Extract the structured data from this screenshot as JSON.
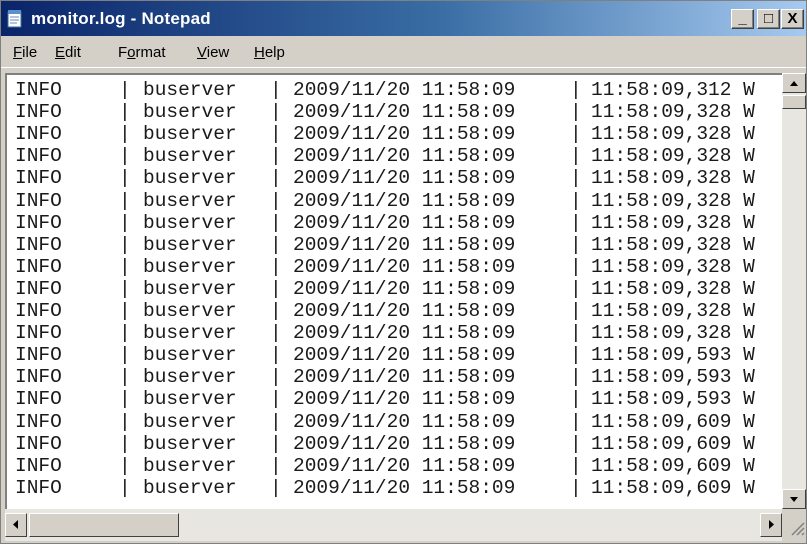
{
  "window": {
    "title": "monitor.log - Notepad",
    "controls": {
      "minimize": "_",
      "maximize": "□",
      "close": "X"
    }
  },
  "menu": {
    "file": {
      "accel": "F",
      "rest": "ile"
    },
    "edit": {
      "accel": "E",
      "rest": "dit"
    },
    "format": {
      "pre": "F",
      "accel": "o",
      "rest": "rmat"
    },
    "view": {
      "accel": "V",
      "rest": "iew"
    },
    "help": {
      "accel": "H",
      "rest": "elp"
    }
  },
  "log": {
    "lines": [
      {
        "level": "INFO",
        "source": "buserver",
        "datetime": "2009/11/20 11:58:09",
        "time": "11:58:09,312 W"
      },
      {
        "level": "INFO",
        "source": "buserver",
        "datetime": "2009/11/20 11:58:09",
        "time": "11:58:09,328 W"
      },
      {
        "level": "INFO",
        "source": "buserver",
        "datetime": "2009/11/20 11:58:09",
        "time": "11:58:09,328 W"
      },
      {
        "level": "INFO",
        "source": "buserver",
        "datetime": "2009/11/20 11:58:09",
        "time": "11:58:09,328 W"
      },
      {
        "level": "INFO",
        "source": "buserver",
        "datetime": "2009/11/20 11:58:09",
        "time": "11:58:09,328 W"
      },
      {
        "level": "INFO",
        "source": "buserver",
        "datetime": "2009/11/20 11:58:09",
        "time": "11:58:09,328 W"
      },
      {
        "level": "INFO",
        "source": "buserver",
        "datetime": "2009/11/20 11:58:09",
        "time": "11:58:09,328 W"
      },
      {
        "level": "INFO",
        "source": "buserver",
        "datetime": "2009/11/20 11:58:09",
        "time": "11:58:09,328 W"
      },
      {
        "level": "INFO",
        "source": "buserver",
        "datetime": "2009/11/20 11:58:09",
        "time": "11:58:09,328 W"
      },
      {
        "level": "INFO",
        "source": "buserver",
        "datetime": "2009/11/20 11:58:09",
        "time": "11:58:09,328 W"
      },
      {
        "level": "INFO",
        "source": "buserver",
        "datetime": "2009/11/20 11:58:09",
        "time": "11:58:09,328 W"
      },
      {
        "level": "INFO",
        "source": "buserver",
        "datetime": "2009/11/20 11:58:09",
        "time": "11:58:09,328 W"
      },
      {
        "level": "INFO",
        "source": "buserver",
        "datetime": "2009/11/20 11:58:09",
        "time": "11:58:09,593 W"
      },
      {
        "level": "INFO",
        "source": "buserver",
        "datetime": "2009/11/20 11:58:09",
        "time": "11:58:09,593 W"
      },
      {
        "level": "INFO",
        "source": "buserver",
        "datetime": "2009/11/20 11:58:09",
        "time": "11:58:09,593 W"
      },
      {
        "level": "INFO",
        "source": "buserver",
        "datetime": "2009/11/20 11:58:09",
        "time": "11:58:09,609 W"
      },
      {
        "level": "INFO",
        "source": "buserver",
        "datetime": "2009/11/20 11:58:09",
        "time": "11:58:09,609 W"
      },
      {
        "level": "INFO",
        "source": "buserver",
        "datetime": "2009/11/20 11:58:09",
        "time": "11:58:09,609 W"
      },
      {
        "level": "INFO",
        "source": "buserver",
        "datetime": "2009/11/20 11:58:09",
        "time": "11:58:09,609 W"
      }
    ]
  },
  "icons": {
    "app": "notepad-icon",
    "scroll_up": "arrow-up-icon",
    "scroll_down": "arrow-down-icon",
    "scroll_left": "arrow-left-icon",
    "scroll_right": "arrow-right-icon",
    "resize": "resize-grip-icon"
  },
  "colors": {
    "title_start": "#0a246a",
    "title_end": "#a6caf0",
    "chrome": "#d4d0c8",
    "text": "#1a1a1a"
  }
}
